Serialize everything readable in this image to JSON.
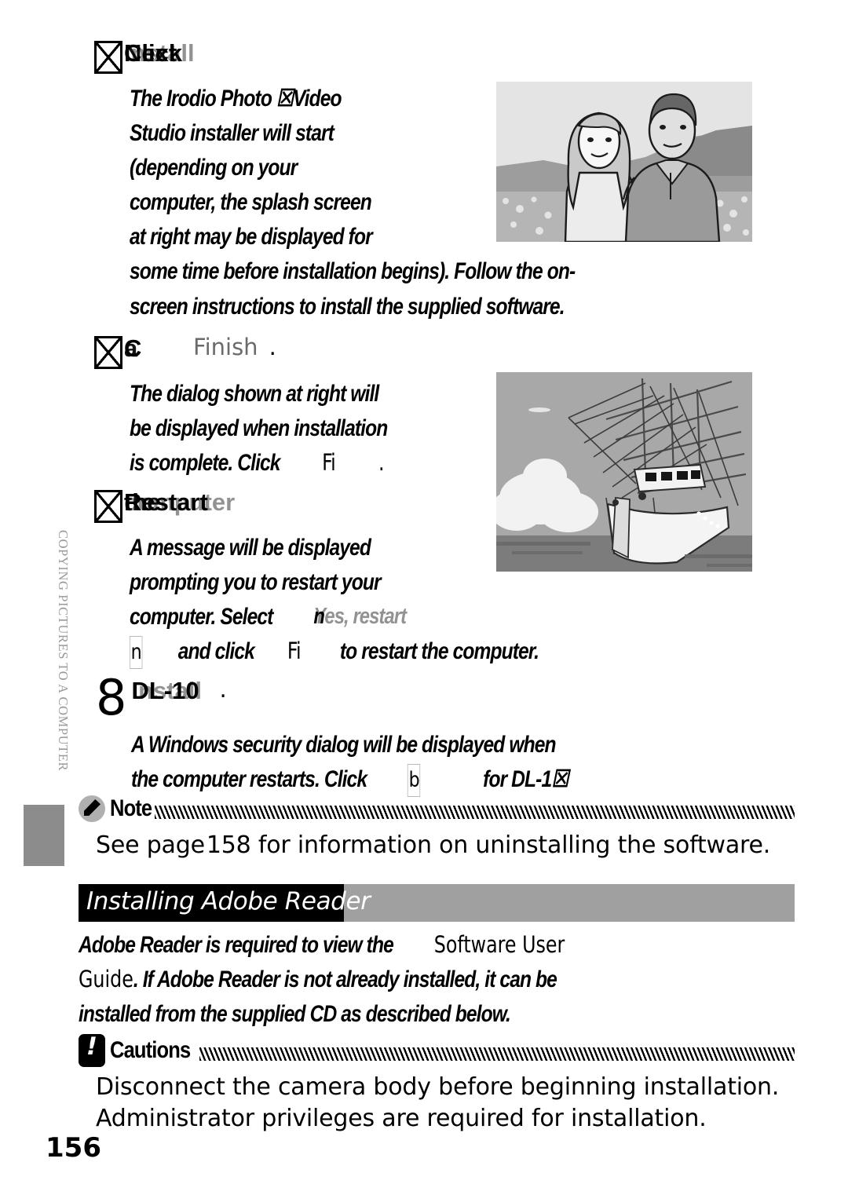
{
  "page": {
    "number": "156",
    "running_head": "COPYING PICTURES TO A COMPUTER"
  },
  "steps": [
    {
      "id": "step-6",
      "marker": "notdef-box",
      "heading_glyphs": [
        "Click",
        "Next",
        "Install"
      ],
      "heading_text": "Click Next.",
      "lines": [
        "The Irodio Photo ☒Video",
        "Studio installer will start",
        "(depending on your",
        "computer, the splash screen",
        "at right may be displayed for",
        "some time before installation begins). Follow the on-",
        "screen instructions to install the supplied software."
      ]
    },
    {
      "id": "step-7a",
      "marker": "notdef-box",
      "heading_glyphs": [
        "C",
        "a"
      ],
      "heading_text": "Click Finish.",
      "heading_button": "Finish",
      "heading_suffix": ".",
      "lines": [
        "The dialog shown at right will",
        "be displayed when installation",
        "is complete. Click"
      ],
      "inline_button": "Fi",
      "inline_button_suffix": "."
    },
    {
      "id": "step-7b",
      "marker": "notdef-box",
      "heading_glyphs": [
        "Restart",
        "the",
        "computer"
      ],
      "heading_text": "Restart the computer.",
      "lines": [
        "A message will be displayed",
        "prompting you to restart your",
        "computer. Select"
      ],
      "select_value": "Yes, restart",
      "select_value2": "n",
      "and_click": "and click",
      "click_button": "Fi",
      "tail": "to restart the computer."
    },
    {
      "id": "step-8",
      "number": "8",
      "heading_glyphs": [
        "Install",
        "DL-10"
      ],
      "heading_text": "Install DL-10.",
      "heading_suffix": ".",
      "lines": [
        "A Windows security dialog will be displayed when",
        "the computer restarts. Click"
      ],
      "inline_button": "b",
      "tail": "for DL-1☒"
    }
  ],
  "figures": [
    {
      "name": "couple-portrait-illustration",
      "caption": ""
    },
    {
      "name": "tall-ship-illustration",
      "caption": ""
    }
  ],
  "note": {
    "icon": "pencil-icon",
    "label": "Note",
    "body": "See page 158 for information on uninstalling the software.",
    "body_prefix": "See page",
    "body_page_ref": "158",
    "body_suffix": "for information on uninstalling the software."
  },
  "section": {
    "title": "Installing Adobe Reader",
    "black_box_color": "#000000",
    "bar_color": "#a0a0a0",
    "text_color": "#ffffff"
  },
  "section_body": {
    "line1_italic": "Adobe Reader is required to view the",
    "line1_plain": "Software User",
    "line2_plain": "Guide",
    "line2_italic": ". If Adobe Reader is not already installed, it can be",
    "line3_italic": "installed from the supplied CD as described below."
  },
  "caution": {
    "icon": "exclamation-icon",
    "label": "Cautions",
    "items": [
      "Disconnect the camera body before beginning installation.",
      "Administrator privileges are required for installation."
    ]
  }
}
